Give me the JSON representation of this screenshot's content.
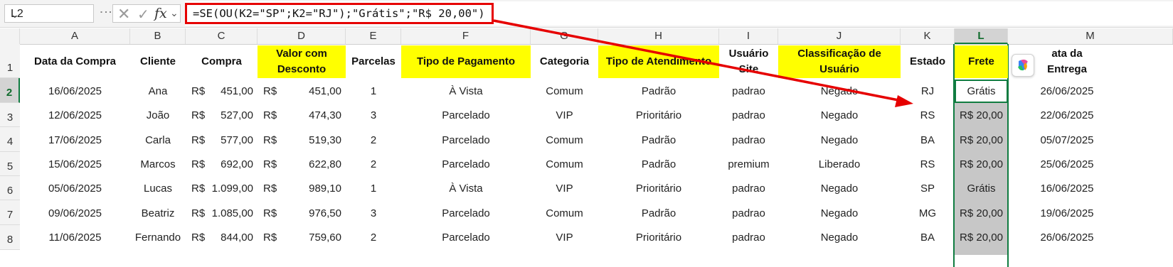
{
  "name_box": "L2",
  "formula": "=SE(OU(K2=\"SP\";K2=\"RJ\");\"Grátis\";\"R$ 20,00\")",
  "icons": {
    "cancel": "x-icon",
    "enter": "check-icon",
    "function": "fx-icon",
    "copilot": "copilot-icon"
  },
  "colors": {
    "highlight": "#ffff00",
    "frete_fill": "#c7c7c7",
    "selection": "#107c41",
    "callout": "#e60000"
  },
  "column_letters": [
    "A",
    "B",
    "C",
    "D",
    "E",
    "F",
    "G",
    "H",
    "I",
    "J",
    "K",
    "L",
    "M"
  ],
  "row_numbers": [
    "1",
    "2",
    "3",
    "4",
    "5",
    "6",
    "7",
    "8"
  ],
  "headers": {
    "data_compra": "Data da Compra",
    "cliente": "Cliente",
    "compra": "Compra",
    "valor_desconto": "Valor com Desconto",
    "parcelas": "Parcelas",
    "tipo_pagamento": "Tipo de Pagamento",
    "categoria": "Categoria",
    "tipo_atendimento": "Tipo de Atendimento",
    "usuario_site": "Usuário Site",
    "classificacao": "Classificação de Usuário",
    "estado": "Estado",
    "frete": "Frete",
    "data_entrega": "ata da Entrega"
  },
  "currency": "R$",
  "rows": [
    {
      "data": "16/06/2025",
      "cliente": "Ana",
      "compra": "451,00",
      "valor": "451,00",
      "parcelas": "1",
      "pagamento": "À Vista",
      "categoria": "Comum",
      "atendimento": "Padrão",
      "usuario": "padrao",
      "classificacao": "Negado",
      "estado": "RJ",
      "frete": "Grátis",
      "entrega": "26/06/2025"
    },
    {
      "data": "12/06/2025",
      "cliente": "João",
      "compra": "527,00",
      "valor": "474,30",
      "parcelas": "3",
      "pagamento": "Parcelado",
      "categoria": "VIP",
      "atendimento": "Prioritário",
      "usuario": "padrao",
      "classificacao": "Negado",
      "estado": "RS",
      "frete": "R$ 20,00",
      "entrega": "22/06/2025"
    },
    {
      "data": "17/06/2025",
      "cliente": "Carla",
      "compra": "577,00",
      "valor": "519,30",
      "parcelas": "2",
      "pagamento": "Parcelado",
      "categoria": "Comum",
      "atendimento": "Padrão",
      "usuario": "padrao",
      "classificacao": "Negado",
      "estado": "BA",
      "frete": "R$ 20,00",
      "entrega": "05/07/2025"
    },
    {
      "data": "15/06/2025",
      "cliente": "Marcos",
      "compra": "692,00",
      "valor": "622,80",
      "parcelas": "2",
      "pagamento": "Parcelado",
      "categoria": "Comum",
      "atendimento": "Padrão",
      "usuario": "premium",
      "classificacao": "Liberado",
      "estado": "RS",
      "frete": "R$ 20,00",
      "entrega": "25/06/2025"
    },
    {
      "data": "05/06/2025",
      "cliente": "Lucas",
      "compra": "1.099,00",
      "valor": "989,10",
      "parcelas": "1",
      "pagamento": "À Vista",
      "categoria": "VIP",
      "atendimento": "Prioritário",
      "usuario": "padrao",
      "classificacao": "Negado",
      "estado": "SP",
      "frete": "Grátis",
      "entrega": "16/06/2025"
    },
    {
      "data": "09/06/2025",
      "cliente": "Beatriz",
      "compra": "1.085,00",
      "valor": "976,50",
      "parcelas": "3",
      "pagamento": "Parcelado",
      "categoria": "Comum",
      "atendimento": "Padrão",
      "usuario": "padrao",
      "classificacao": "Negado",
      "estado": "MG",
      "frete": "R$ 20,00",
      "entrega": "19/06/2025"
    },
    {
      "data": "11/06/2025",
      "cliente": "Fernando",
      "compra": "844,00",
      "valor": "759,60",
      "parcelas": "2",
      "pagamento": "Parcelado",
      "categoria": "VIP",
      "atendimento": "Prioritário",
      "usuario": "padrao",
      "classificacao": "Negado",
      "estado": "BA",
      "frete": "R$ 20,00",
      "entrega": "26/06/2025"
    }
  ]
}
